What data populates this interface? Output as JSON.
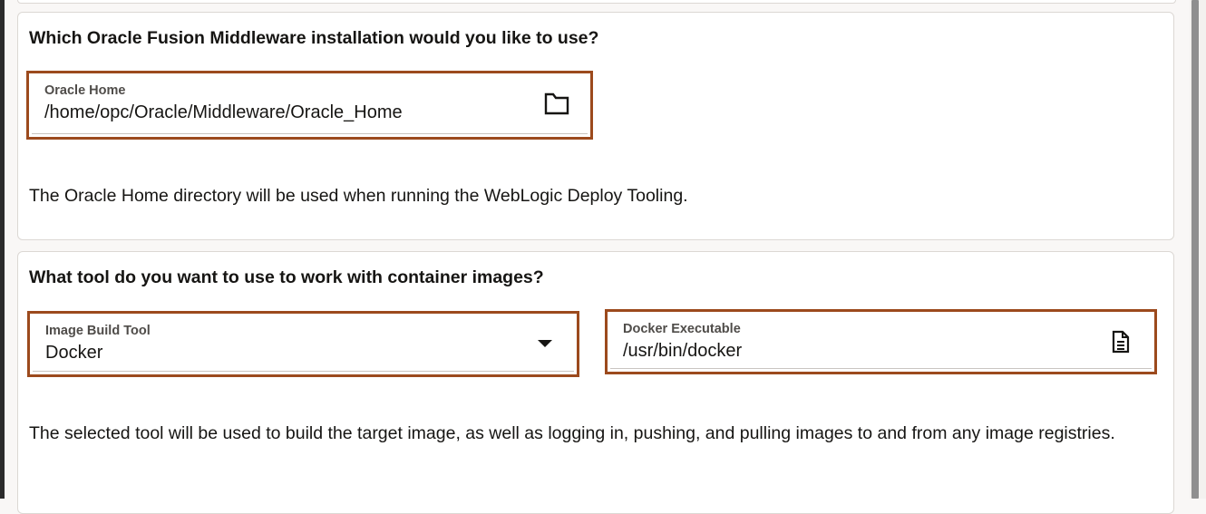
{
  "middleware_section": {
    "question": "Which Oracle Fusion Middleware installation would you like to use?",
    "oracle_home": {
      "label": "Oracle Home",
      "value": "/home/opc/Oracle/Middleware/Oracle_Home",
      "icon": "folder-icon"
    },
    "description": "The Oracle Home directory will be used when running the WebLogic Deploy Tooling."
  },
  "container_section": {
    "question": "What tool do you want to use to work with container images?",
    "image_build_tool": {
      "label": "Image Build Tool",
      "value": "Docker",
      "icon": "caret-down-icon"
    },
    "docker_executable": {
      "label": "Docker Executable",
      "value": "/usr/bin/docker",
      "icon": "file-icon"
    },
    "description": "The selected tool will be used to build the target image, as well as logging in, pushing, and pulling images to and from any image registries."
  },
  "colors": {
    "highlight_border": "#9c4a1d",
    "card_background": "#ffffff",
    "page_background": "#f9f7f6",
    "text": "#161513",
    "label_text": "#4f4c49"
  }
}
